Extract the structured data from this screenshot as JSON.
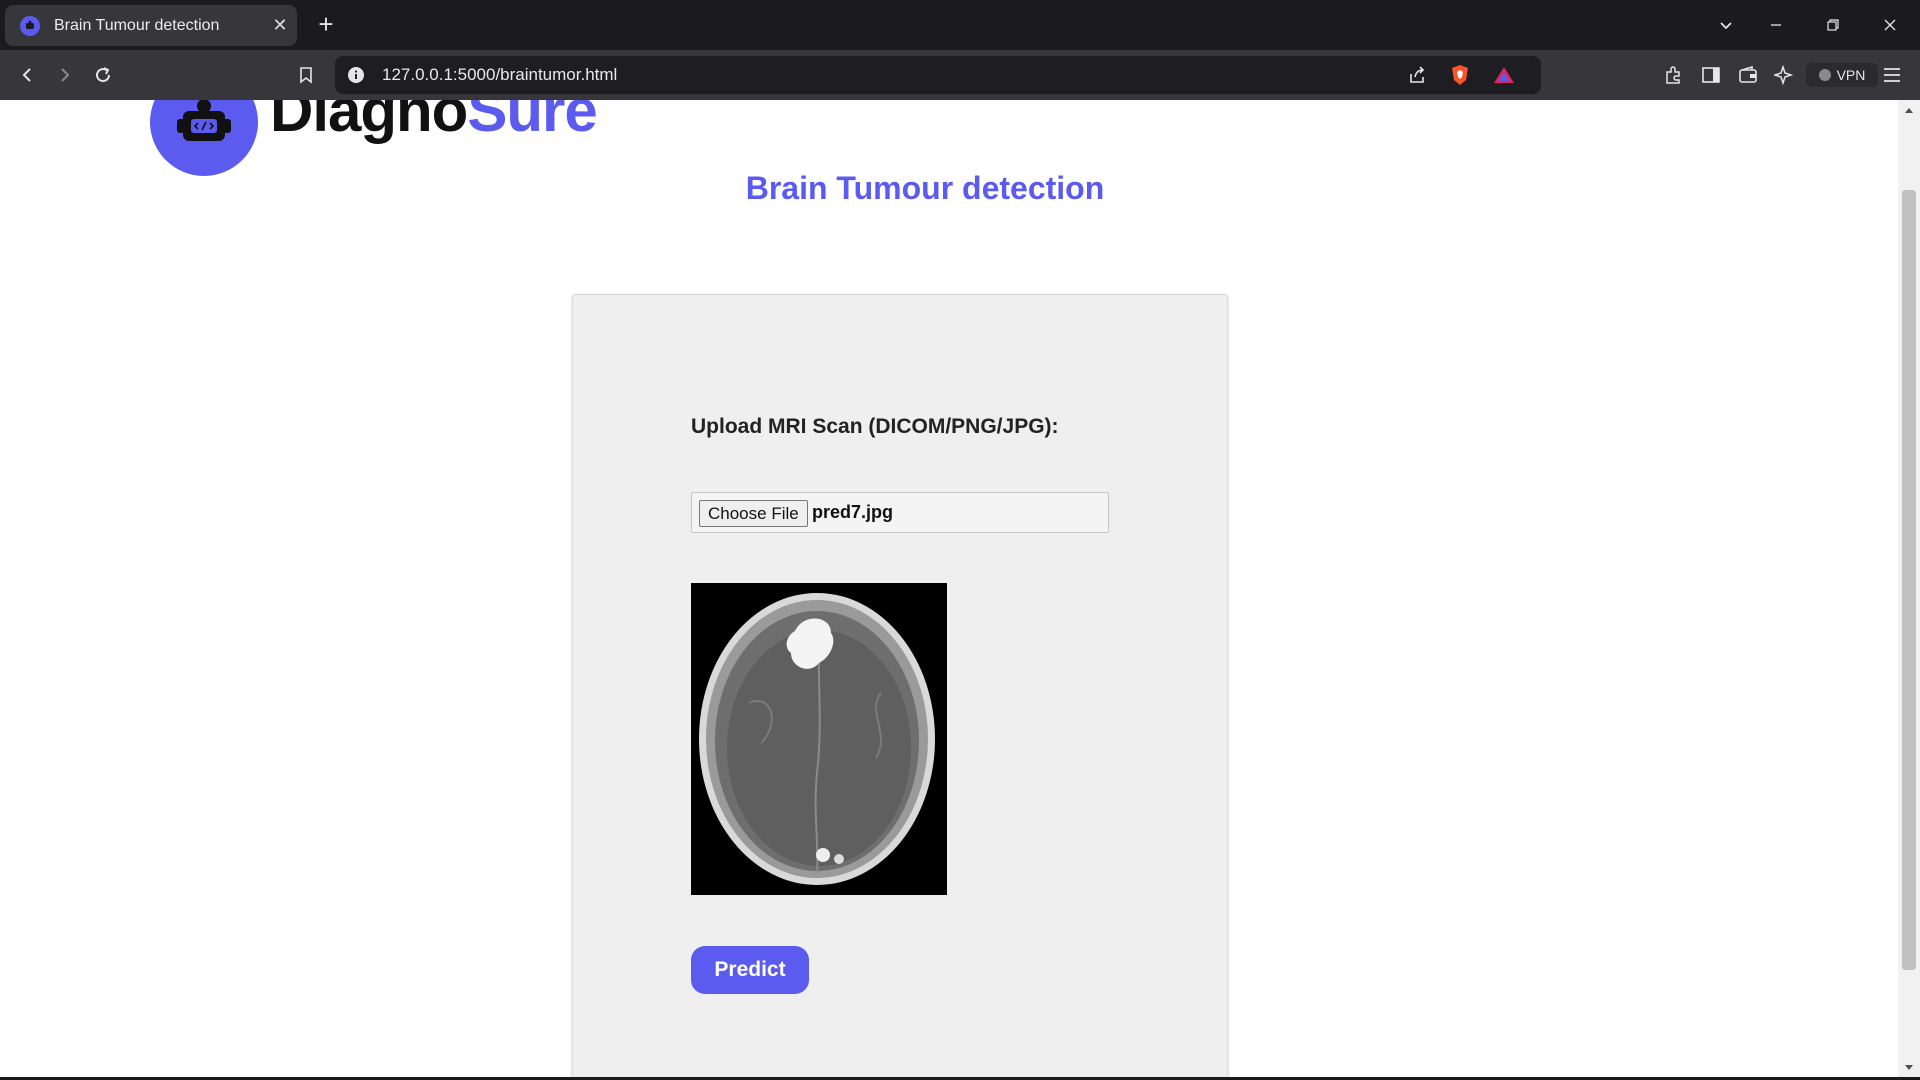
{
  "browser": {
    "tab_title": "Brain Tumour detection",
    "tab_close": "✕",
    "new_tab": "+",
    "url": "127.0.0.1:5000/braintumor.html",
    "vpn_label": "VPN"
  },
  "page": {
    "brand_part1": "Diagno",
    "brand_part2": "Sure",
    "title": "Brain Tumour detection",
    "upload_label": "Upload MRI Scan (DICOM/PNG/JPG):",
    "file_button": "Choose File",
    "file_name": "pred7.jpg",
    "predict_button": "Predict"
  },
  "colors": {
    "accent": "#5b5bf0",
    "card_bg": "#efefef",
    "chrome_dark": "#1b1b1f",
    "toolbar": "#36363b"
  }
}
